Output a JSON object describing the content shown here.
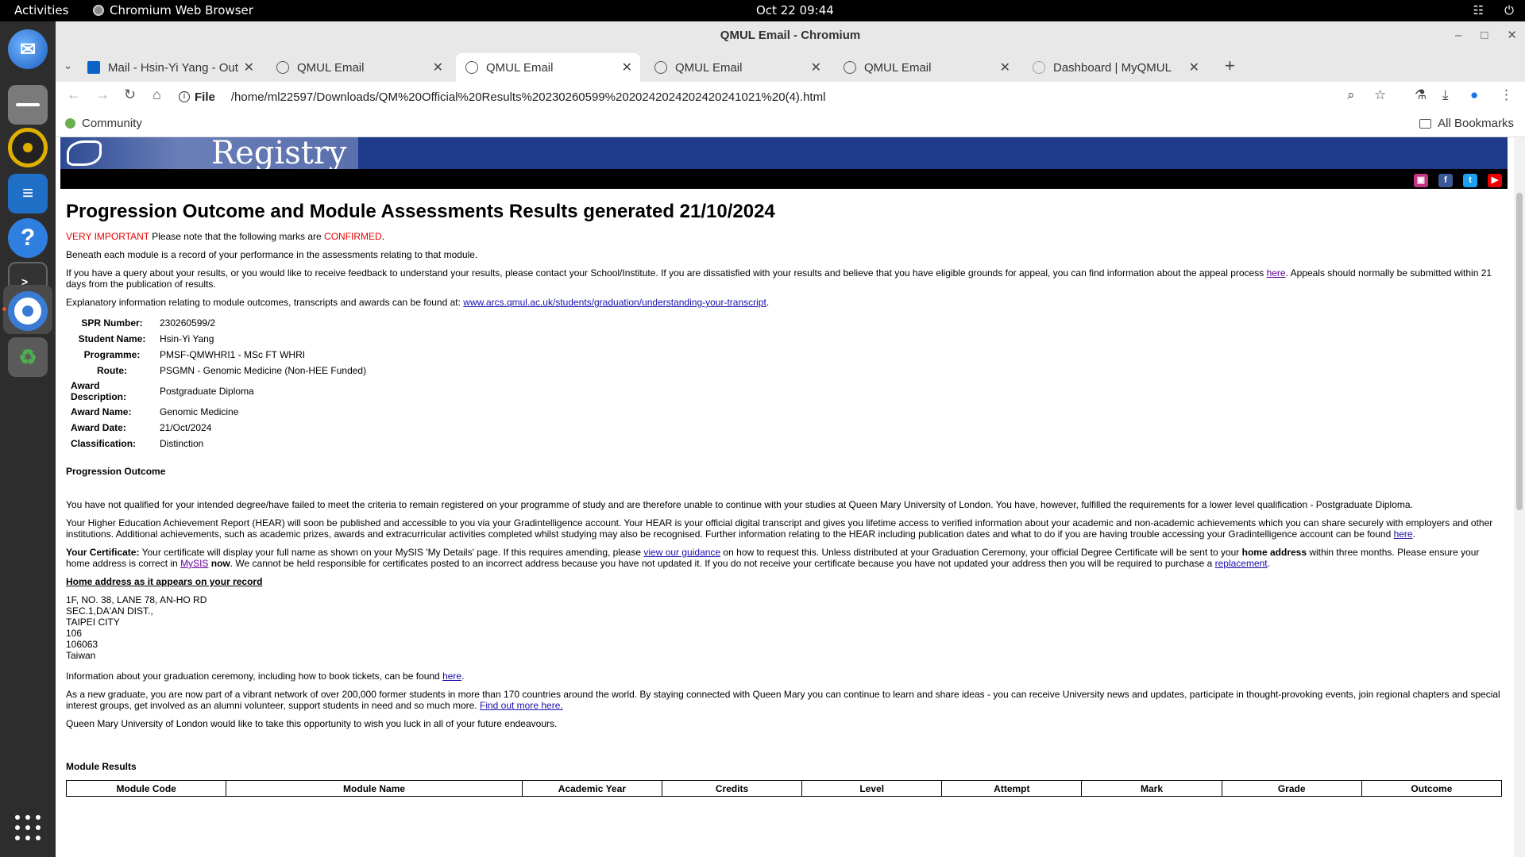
{
  "topbar": {
    "activities": "Activities",
    "app": "Chromium Web Browser",
    "clock": "Oct 22  09:44"
  },
  "window": {
    "title": "QMUL Email - Chromium"
  },
  "tabs": [
    {
      "label": "Mail - Hsin-Yi Yang - Outl",
      "icon": "outlook-icon"
    },
    {
      "label": "QMUL Email",
      "icon": "globe-icon"
    },
    {
      "label": "QMUL Email",
      "icon": "globe-icon"
    },
    {
      "label": "QMUL Email",
      "icon": "globe-icon"
    },
    {
      "label": "QMUL Email",
      "icon": "globe-icon"
    },
    {
      "label": "Dashboard | MyQMUL",
      "icon": "dashboard-icon"
    }
  ],
  "omnibox": {
    "scheme": "File",
    "url": "/home/ml22597/Downloads/QM%20Official%20Results%20230260599%2020242024202420241021%20(4).html"
  },
  "bookmarks": {
    "community": "Community",
    "all": "All Bookmarks"
  },
  "banner": {
    "title": "Registry"
  },
  "page": {
    "heading": "Progression Outcome and Module Assessments Results generated 21/10/2024",
    "important_prefix": "VERY IMPORTANT",
    "important_mid": " Please note that the following marks are ",
    "important_status": "CONFIRMED",
    "important_end": ".",
    "beneath": "Beneath each module is a record of your performance in the assessments relating to that module.",
    "query_a": "If you have a query about your results, or you would like to receive feedback to understand your results, please contact your School/Institute. If you are dissatisfied with your results and believe that you have eligible grounds for appeal, you can find information about the appeal process ",
    "query_link": "here",
    "query_b": ". Appeals should normally be submitted within 21 days from the publication of results.",
    "explanatory_a": "Explanatory information relating to module outcomes, transcripts and awards can be found at: ",
    "explanatory_link": "www.arcs.qmul.ac.uk/students/graduation/understanding-your-transcript",
    "explanatory_b": ".",
    "details": [
      {
        "label": "SPR Number:",
        "value": "230260599/2"
      },
      {
        "label": "Student Name:",
        "value": "Hsin-Yi Yang"
      },
      {
        "label": "Programme:",
        "value": "PMSF-QMWHRI1 - MSc FT WHRI"
      },
      {
        "label": "Route:",
        "value": "PSGMN - Genomic Medicine (Non-HEE Funded)"
      },
      {
        "label": "Award Description:",
        "value": "Postgraduate Diploma"
      },
      {
        "label": "Award Name:",
        "value": "Genomic Medicine"
      },
      {
        "label": "Award Date:",
        "value": "21/Oct/2024"
      },
      {
        "label": "Classification:",
        "value": "Distinction"
      }
    ],
    "progression_title": "Progression Outcome",
    "progression_text": "You have not qualified for your intended degree/have failed to meet the criteria to remain registered on your programme of study and are therefore unable to continue with your studies at Queen Mary University of London. You have, however, fulfilled the requirements for a lower level qualification - Postgraduate Diploma.",
    "hear_a": "Your Higher Education Achievement Report (HEAR) will soon be published and accessible to you via your Gradintelligence account. Your HEAR is your official digital transcript and gives you lifetime access to verified information about your academic and non-academic achievements which you can share securely with employers and other institutions. Additional achievements, such as academic prizes, awards and extracurricular activities completed whilst studying may also be recognised. Further information relating to the HEAR including publication dates and what to do if you are having trouble accessing your Gradintelligence account can be found ",
    "hear_link": "here",
    "hear_b": ".",
    "cert_label": "Your Certificate:",
    "cert_a": " Your certificate will display your full name as shown on your MySIS 'My Details' page. If this requires amending, please ",
    "cert_link1": "view our guidance",
    "cert_b": " on how to request this. Unless distributed at your Graduation Ceremony, your official Degree Certificate will be sent to your ",
    "cert_bold": "home address",
    "cert_c": " within three months. Please ensure your home address is correct in ",
    "cert_link2": "MySIS",
    "cert_now": " now",
    "cert_d": ". We cannot be held responsible for certificates posted to an incorrect address because you have not updated it. If you do not receive your certificate because you have not updated your address then you will be required to purchase a ",
    "cert_link3": "replacement",
    "cert_e": ".",
    "address_title": "Home address as it appears on your record",
    "address": [
      "1F, NO. 38, LANE 78, AN-HO RD",
      "SEC.1,DA'AN DIST.,",
      "TAIPEI CITY",
      "106",
      "106063",
      "Taiwan"
    ],
    "ceremony_a": "Information about your graduation ceremony, including how to book tickets, can be found ",
    "ceremony_link": "here",
    "ceremony_b": ".",
    "network_a": "As a new graduate, you are now part of a vibrant network of over 200,000 former students in more than 170 countries around the world. By staying connected with Queen Mary you can continue to learn and share ideas - you can receive University news and updates, participate in thought-provoking events, join regional chapters and special interest groups, get involved as an alumni volunteer, support students in need and so much more. ",
    "network_link": "Find out more here.",
    "wish": "Queen Mary University of London would like to take this opportunity to wish you luck in all of your future endeavours.",
    "module_results_title": "Module Results",
    "module_columns": [
      "Module Code",
      "Module Name",
      "Academic Year",
      "Credits",
      "Level",
      "Attempt",
      "Mark",
      "Grade",
      "Outcome"
    ]
  }
}
